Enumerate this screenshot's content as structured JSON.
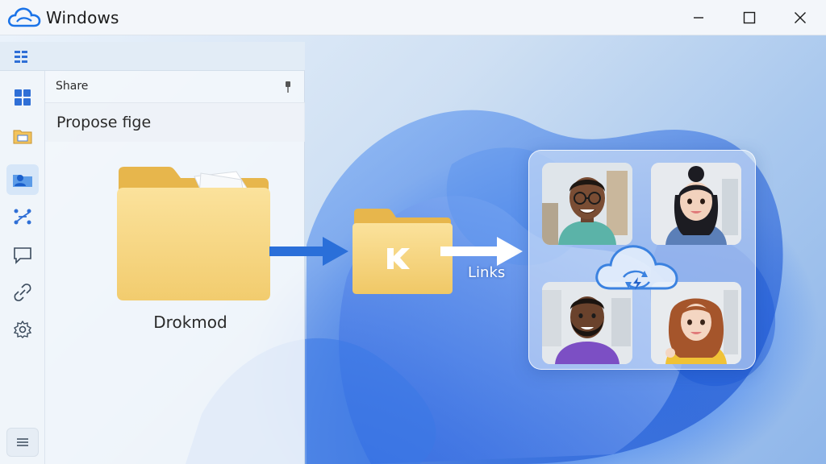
{
  "window": {
    "title": "Windows",
    "minimize_icon": "minimize-icon",
    "maximize_icon": "maximize-icon",
    "close_icon": "close-icon"
  },
  "panel": {
    "share_label": "Share",
    "heading": "Propose fige",
    "folder_caption": "Drokmod"
  },
  "rail": {
    "items": [
      {
        "icon": "apps-grid-icon",
        "active": false
      },
      {
        "icon": "folder-icon",
        "active": false
      },
      {
        "icon": "shared-folder-icon",
        "active": true
      },
      {
        "icon": "connections-icon",
        "active": false
      },
      {
        "icon": "chat-icon",
        "active": false
      },
      {
        "icon": "link-icon",
        "active": false
      },
      {
        "icon": "settings-icon",
        "active": false
      }
    ],
    "bottom_icon": "menu-icon"
  },
  "flow": {
    "links_label": "Links"
  },
  "colors": {
    "accent": "#1a73e8",
    "folder": "#f7d27a",
    "folder_dark": "#e9b84f"
  }
}
